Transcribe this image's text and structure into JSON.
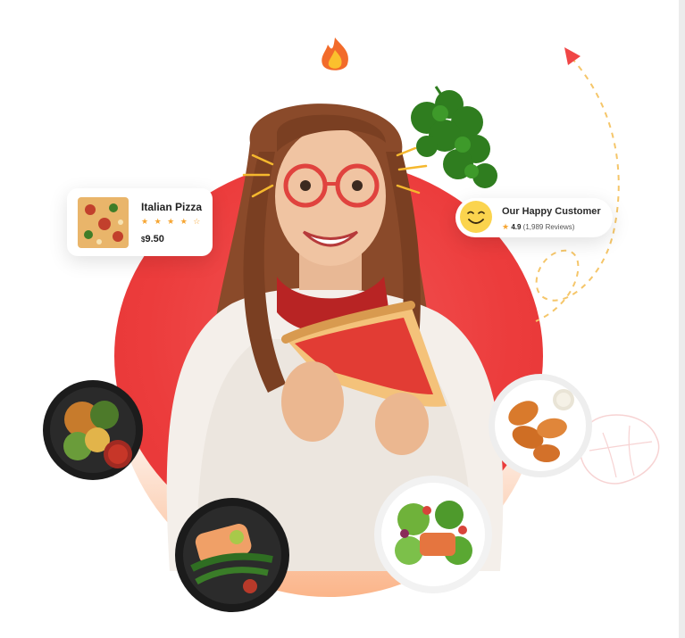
{
  "product_card": {
    "title": "Italian Pizza",
    "stars": "★ ★ ★ ★ ☆",
    "currency": "$",
    "price": "9.50"
  },
  "customer_card": {
    "title": "Our Happy Customer",
    "rating": "4.9",
    "reviews": "(1,989 Reviews)"
  },
  "colors": {
    "primary_red": "#ec3c3c",
    "accent_orange": "#fbb58a",
    "star_yellow": "#f6a531",
    "arrow_red": "#f04646",
    "dash_yellow": "#f5c66a"
  },
  "icons": [
    "fire-icon",
    "smiley-icon",
    "star-icon",
    "arrow-icon"
  ]
}
